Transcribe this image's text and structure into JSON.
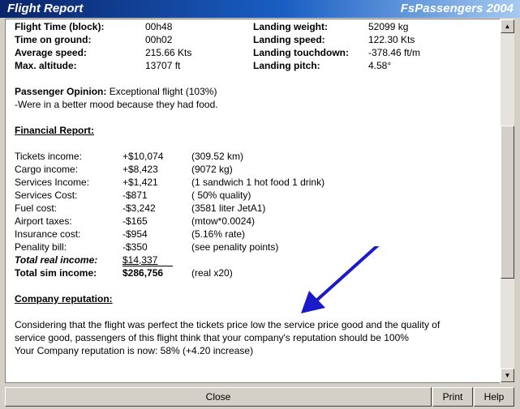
{
  "window": {
    "title": "Flight Report",
    "brand": "FsPassengers 2004"
  },
  "flight_stats": {
    "left": [
      {
        "label": "Flight Time (block):",
        "value": "00h48"
      },
      {
        "label": "Time on ground:",
        "value": "00h02"
      },
      {
        "label": "Average speed:",
        "value": "215.66 Kts"
      },
      {
        "label": "Max. altitude:",
        "value": "13707 ft"
      }
    ],
    "right": [
      {
        "label": "Landing weight:",
        "value": "52099 kg"
      },
      {
        "label": "Landing speed:",
        "value": "122.30 Kts"
      },
      {
        "label": "Landing touchdown:",
        "value": "-378.46 ft/m"
      },
      {
        "label": "Landing pitch:",
        "value": "4.58°"
      }
    ]
  },
  "opinion": {
    "label": "Passenger Opinion:",
    "value": "Exceptional flight (103%)",
    "note": "-Were in a better mood because they had food."
  },
  "financial": {
    "heading": "Financial Report:",
    "rows": [
      {
        "label": "Tickets income:",
        "amount": "+$10,074",
        "detail": "(309.52 km)"
      },
      {
        "label": "Cargo income:",
        "amount": "+$8,423",
        "detail": "(9072 kg)"
      },
      {
        "label": "Services Income:",
        "amount": "+$1,421",
        "detail": "(1 sandwich 1 hot food 1 drink)"
      },
      {
        "label": "Services Cost:",
        "amount": "-$871",
        "detail": "( 50% quality)"
      },
      {
        "label": "Fuel cost:",
        "amount": "-$3,242",
        "detail": "(3581 liter JetA1)"
      },
      {
        "label": "Airport taxes:",
        "amount": "-$165",
        "detail": "(mtow*0.0024)"
      },
      {
        "label": "Insurance cost:",
        "amount": "-$954",
        "detail": "(5.16% rate)"
      },
      {
        "label": "Penality bill:",
        "amount": "-$350",
        "detail": "(see penality points)"
      }
    ],
    "total_real": {
      "label": "Total real income:",
      "amount": "$14,337"
    },
    "total_sim": {
      "label": "Total sim income:",
      "amount": "$286,756",
      "detail": "(real x20)"
    }
  },
  "reputation": {
    "heading": "Company reputation:",
    "line1": "Considering that the flight was perfect the tickets price low the service price good and the quality of",
    "line2": "service good, passengers of this flight think that your company's reputation should be 100%",
    "line3": "Your Company reputation is now: 58% (+4.20 increase)"
  },
  "buttons": {
    "close": "Close",
    "print": "Print",
    "help": "Help"
  },
  "colors": {
    "title_gradient_start": "#0a246a",
    "title_gradient_end": "#a6caf0",
    "arrow": "#1a1ac8"
  }
}
